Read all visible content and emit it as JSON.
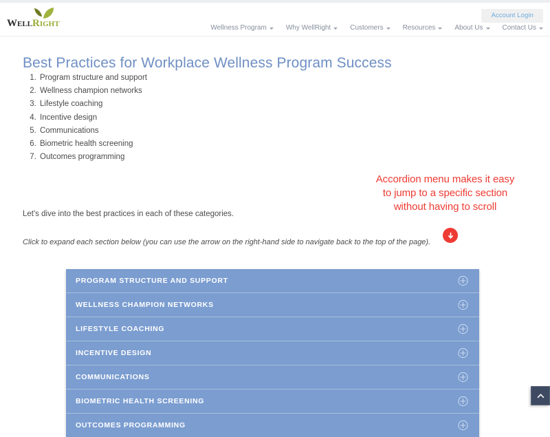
{
  "header": {
    "logo": {
      "part1": "Well",
      "part2": "Right",
      "leaf_icon": "leaf-icon"
    },
    "account_login_label": "Account Login",
    "nav_items": [
      {
        "label": "Wellness Program",
        "has_dropdown": true
      },
      {
        "label": "Why WellRight",
        "has_dropdown": true
      },
      {
        "label": "Customers",
        "has_dropdown": true
      },
      {
        "label": "Resources",
        "has_dropdown": true
      },
      {
        "label": "About Us",
        "has_dropdown": true
      },
      {
        "label": "Contact Us",
        "has_dropdown": true
      }
    ]
  },
  "main": {
    "title": "Best Practices for Workplace Wellness Program Success",
    "categories": [
      "Program structure and support",
      "Wellness champion networks",
      "Lifestyle coaching",
      "Incentive design",
      "Communications",
      "Biometric health screening",
      "Outcomes programming"
    ],
    "dive_text": "Let's dive into the best practices in each of these categories.",
    "click_expand_text": "Click to expand each section below (you can use the arrow on the right-hand side to navigate back to the top of the page)."
  },
  "annotation": {
    "line1": "Accordion menu makes it easy",
    "line2": "to jump to a specific section",
    "line3": "without having to scroll",
    "color": "#ee3b33",
    "arrow_icon": "arrow-down-circle-icon"
  },
  "accordion": {
    "background_color": "#7b9dd0",
    "expand_icon": "plus-circle-icon",
    "items": [
      {
        "label": "Program structure and support"
      },
      {
        "label": "Wellness champion networks"
      },
      {
        "label": "Lifestyle coaching"
      },
      {
        "label": "Incentive design"
      },
      {
        "label": "Communications"
      },
      {
        "label": "Biometric health screening"
      },
      {
        "label": "Outcomes programming"
      }
    ]
  },
  "back_to_top": {
    "icon": "chevron-up-icon",
    "color": "#3d4a61"
  }
}
